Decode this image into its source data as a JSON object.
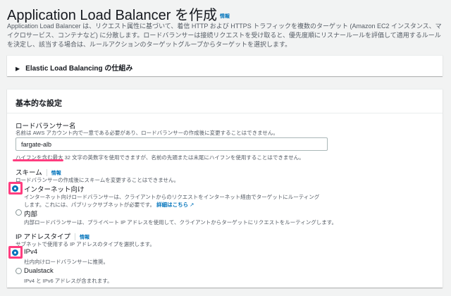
{
  "header": {
    "title": "Application Load Balancer を作成",
    "info": "情報",
    "description": "Application Load Balancer は、リクエスト属性に基づいて、着信 HTTP および HTTPS トラフィックを複数のターゲット (Amazon EC2 インスタンス、マイクロサービス、コンテナなど) に分散します。ロードバランサーは接続リクエストを受け取ると、優先度順にリスナールールを評価して適用するルールを決定し、該当する場合は、ルールアクションのターゲットグループからターゲットを選択します。"
  },
  "expander": {
    "label": "Elastic Load Balancing の仕組み"
  },
  "basic": {
    "title": "基本的な設定",
    "name": {
      "label": "ロードバランサー名",
      "description": "名前は AWS アカウント内で一意である必要があり、ロードバランサーの作成後に変更することはできません。",
      "value": "fargate-alb",
      "hint": "ハイフンを含む最大 32 文字の英数字を使用できますが、名前の先頭または末尾にハイフンを使用することはできません。"
    },
    "scheme": {
      "label": "スキーム",
      "info": "情報",
      "description": "ロードバランサーの作成後にスキームを変更することはできません。",
      "options": [
        {
          "label": "インターネット向け",
          "description": "インターネット向けロードバランサーは、クライアントからのリクエストをインターネット経由でターゲットにルーティングします。これには、パブリックサブネットが必要です。",
          "link": "詳細はこちら",
          "selected": true
        },
        {
          "label": "内部",
          "description": "内部ロードバランサーは、プライベート IP アドレスを使用して、クライアントからターゲットにリクエストをルーティングします。",
          "selected": false
        }
      ]
    },
    "ip": {
      "label": "IP アドレスタイプ",
      "info": "情報",
      "description": "サブネットで使用する IP アドレスのタイプを選択します。",
      "options": [
        {
          "label": "IPv4",
          "description": "社内向けロードバランサーに推奨。",
          "selected": true
        },
        {
          "label": "Dualstack",
          "description": "IPv4 と IPv6 アドレスが含まれます。",
          "selected": false
        }
      ]
    }
  },
  "colors": {
    "accent": "#0073bb",
    "highlight": "#ff3d7f"
  }
}
